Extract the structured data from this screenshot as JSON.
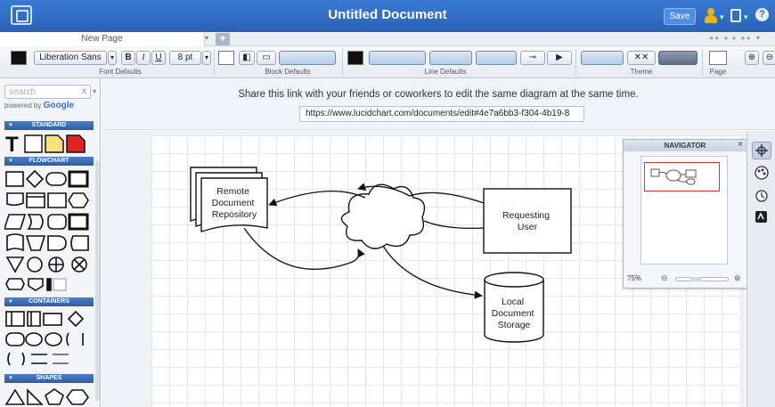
{
  "app": {
    "title": "Untitled Document",
    "save_label": "Save",
    "help_label": "?"
  },
  "tabs": {
    "page_tab": "New Page",
    "add_label": "+"
  },
  "toolbar": {
    "font_name": "Liberation Sans",
    "bold": "B",
    "italic": "I",
    "underline": "U",
    "font_size": "8 pt",
    "font_defaults_label": "Font Defaults",
    "block_defaults_label": "Block Defaults",
    "line_defaults_label": "Line Defaults",
    "theme_label": "Theme",
    "page_label": "Page"
  },
  "sidebar": {
    "search_placeholder": "search",
    "clear": "x",
    "powered_by": "powered by",
    "google": "Google",
    "libraries": [
      "STANDARD",
      "FLOWCHART",
      "CONTAINERS",
      "SHAPES"
    ]
  },
  "share": {
    "message": "Share this link with your friends or coworkers to edit the same diagram at the same time.",
    "link": "https://www.lucidchart.com/documents/edit#4e7a6bb3-f304-4b19-8"
  },
  "diagram": {
    "repository_label": [
      "Remote",
      "Document",
      "Repository"
    ],
    "user_label": [
      "Requesting",
      "User"
    ],
    "storage_label": [
      "Local",
      "Document",
      "Storage"
    ]
  },
  "navigator": {
    "title": "NAVIGATOR",
    "zoom": "75%",
    "close": "×"
  },
  "colors": {
    "titlebar": "#2a62b6",
    "library_header": "#2d5ca3",
    "navigator_frame": "#e03030"
  }
}
